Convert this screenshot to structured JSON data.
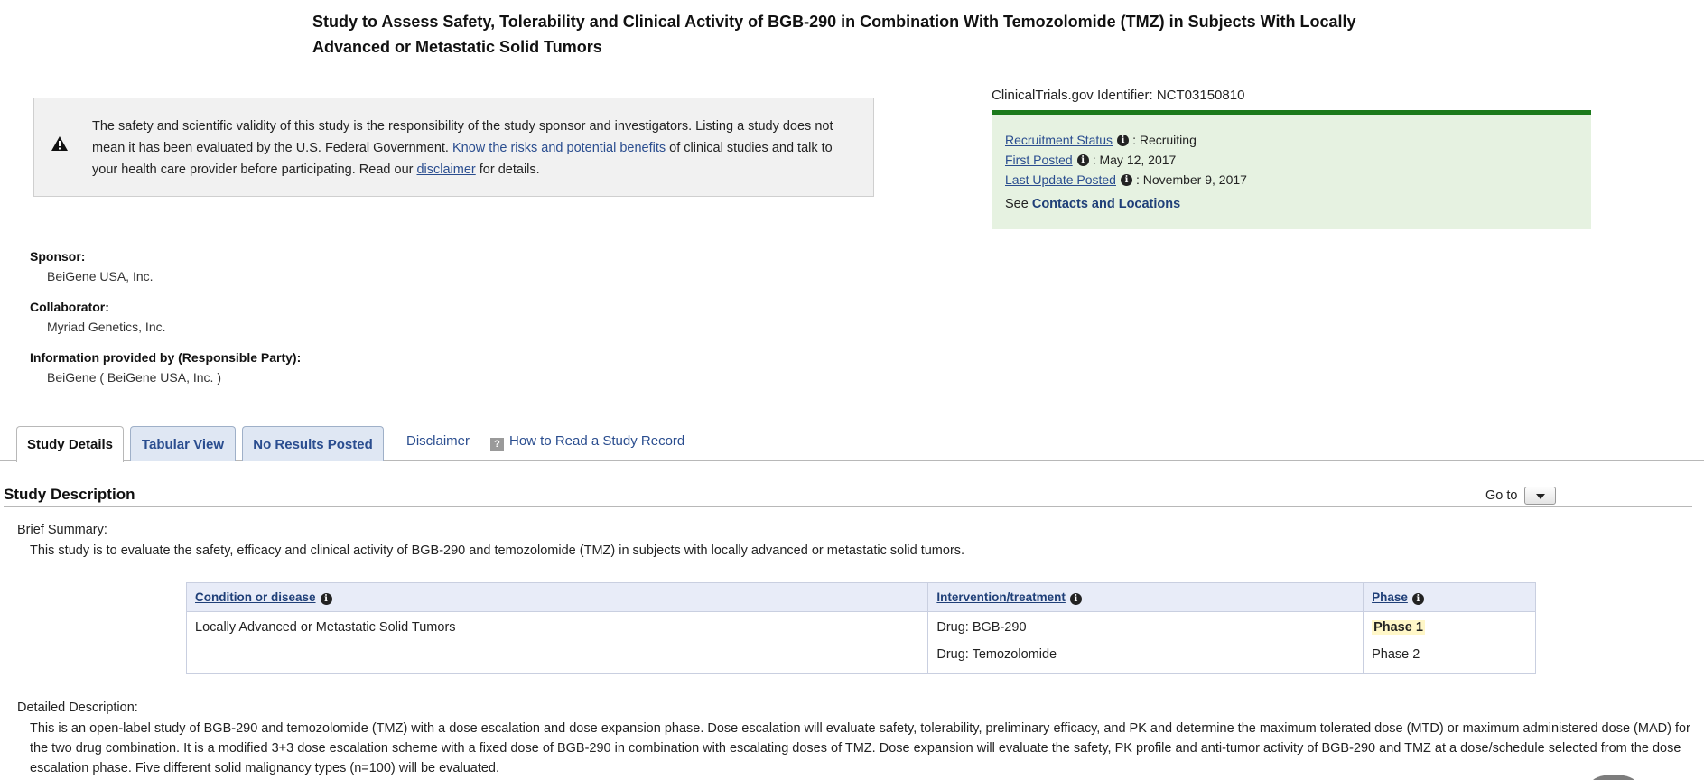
{
  "title": "Study to Assess Safety, Tolerability and Clinical Activity of BGB-290 in Combination With Temozolomide (TMZ) in Subjects With Locally Advanced or Metastatic Solid Tumors",
  "disclaimer": {
    "text_1": "The safety and scientific validity of this study is the responsibility of the study sponsor and investigators. Listing a study does not mean it has been evaluated by the U.S. Federal Government. ",
    "link_risks": "Know the risks and potential benefits",
    "text_2": " of clinical studies and talk to your health care provider before participating. Read our ",
    "link_disclaimer": "disclaimer",
    "text_3": " for details."
  },
  "identifier": {
    "label": "ClinicalTrials.gov Identifier: ",
    "value": "NCT03150810"
  },
  "status": {
    "recruitment_label": "Recruitment Status",
    "recruitment_value": ": Recruiting",
    "first_posted_label": "First Posted",
    "first_posted_value": ": May 12, 2017",
    "last_update_label": "Last Update Posted",
    "last_update_value": ": November 9, 2017",
    "see_text": "See ",
    "contacts_link": "Contacts and Locations"
  },
  "sponsor": {
    "sponsor_label": "Sponsor:",
    "sponsor_value": "BeiGene USA, Inc.",
    "collaborator_label": "Collaborator:",
    "collaborator_value": "Myriad Genetics, Inc.",
    "responsible_label": "Information provided by (Responsible Party):",
    "responsible_value": "BeiGene ( BeiGene USA, Inc. )"
  },
  "tabs": {
    "study_details": "Study Details",
    "tabular_view": "Tabular View",
    "no_results": "No Results Posted",
    "disclaimer": "Disclaimer",
    "how_to_read": "How to Read a Study Record"
  },
  "study_description": {
    "title": "Study Description",
    "goto_label": "Go to",
    "brief_summary_label": "Brief Summary:",
    "brief_summary_text": "This study is to evaluate the safety, efficacy and clinical activity of BGB-290 and temozolomide (TMZ) in subjects with locally advanced or metastatic solid tumors.",
    "table": {
      "headers": [
        "Condition or disease",
        "Intervention/treatment",
        "Phase"
      ],
      "condition": "Locally Advanced or Metastatic Solid Tumors",
      "interventions": [
        "Drug: BGB-290",
        "Drug: Temozolomide"
      ],
      "phases": [
        "Phase 1",
        "Phase 2"
      ]
    },
    "detailed_label": "Detailed Description:",
    "detailed_text": "This is an open-label study of BGB-290 and temozolomide (TMZ) with a dose escalation and dose expansion phase. Dose escalation will evaluate safety, tolerability, preliminary efficacy, and PK and determine the maximum tolerated dose (MTD) or maximum administered dose (MAD) for the two drug combination. It is a modified 3+3 dose escalation scheme with a fixed dose of BGB-290 in combination with escalating doses of TMZ. Dose expansion will evaluate the safety, PK profile and anti-tumor activity of BGB-290 and TMZ at a dose/schedule selected from the dose escalation phase. Five different solid malignancy types (n=100) will be evaluated."
  },
  "colors": {
    "link": "#2a4d8f",
    "status_bar": "#1c7a1c",
    "status_bg": "#e6f2e1",
    "table_header_bg": "#e8ecf8"
  }
}
